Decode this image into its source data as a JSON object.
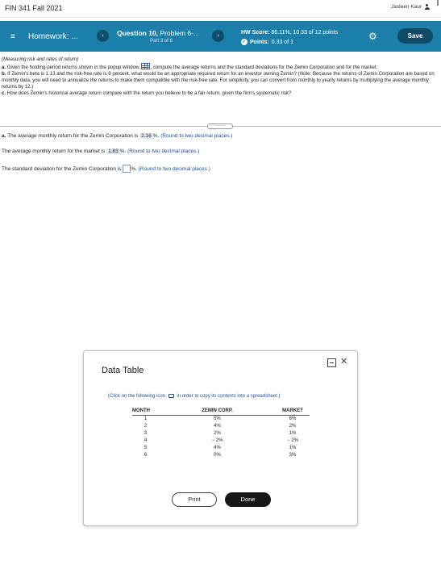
{
  "top": {
    "course_title": "FIN 341 Fall 2021",
    "user_name": "Jasleen Kaur"
  },
  "hwbar": {
    "menu_glyph": "≡",
    "homework_label": "Homework: ...",
    "prev_glyph": "‹",
    "next_glyph": "›",
    "question_title": "Question 10, ",
    "question_problem": "Problem 6-...",
    "part": "Part 3 of 6",
    "score_label": "HW Score: ",
    "score_value": "86.11%, 10.33 of 12 points",
    "points_label": "Points: ",
    "points_value": "0.33 of 1",
    "save_label": "Save",
    "accent": "#1b7fa9"
  },
  "problem": {
    "intro": "(Measuring risk and rates of return)",
    "part_a_prefix": "a.",
    "part_a_text1": " Given the holding-period returns shown in the popup window, ",
    "part_a_text2": ", compute the average returns and the standard deviations for the Zemin Corporation and for the market.",
    "part_b_prefix": "b.",
    "part_b_text": " If Zemin's beta is 1.13 and the risk-free rate is 9 percent, what would be an appropriate required return for an investor owning Zemin? (",
    "part_b_note_label": "Note:",
    "part_b_note": " Because the returns of Zemin Corporation are based on monthly data, you will need to annualize the returns to make them compatible with the risk-free rate. For simplicity, you can convert from monthly to yearly returns by multiplying the average monthly returns by 12.)",
    "part_c_prefix": "c.",
    "part_c_text": " How does Zemin's historical average return compare with the return you believe to be a fair return, given the firm's systematic risk?",
    "expand_glyph": "·······"
  },
  "answers": {
    "row1_prefix": "a.",
    "row1_text": " The average monthly return for the Zemin Corporation is ",
    "row1_value": "2.16",
    "row1_unit": "%. ",
    "row1_hint": "(Round to two decimal places.)",
    "row2_text": "The average monthly return for the market is ",
    "row2_value": "1.83",
    "row2_unit": "%. ",
    "row2_hint": "(Round to two decimal places.)",
    "row3_text": "The standard deviation for the Zemin Corporation is ",
    "row3_unit": "%. ",
    "row3_hint": "(Round to two decimal places.)"
  },
  "modal": {
    "title": "Data Table",
    "close_glyph": "✕",
    "instr_before": "(Click on the following icon ",
    "instr_after": " in order to copy its contents into a spreadsheet.)",
    "columns": [
      "MONTH",
      "ZEMIN CORP.",
      "MARKET"
    ],
    "rows": [
      [
        "1",
        "5%",
        "6%"
      ],
      [
        "2",
        "4%",
        "2%"
      ],
      [
        "3",
        "2%",
        "1%"
      ],
      [
        "4",
        "− 2%",
        "− 2%"
      ],
      [
        "5",
        "4%",
        "1%"
      ],
      [
        "6",
        "0%",
        "3%"
      ]
    ],
    "print_label": "Print",
    "done_label": "Done"
  }
}
